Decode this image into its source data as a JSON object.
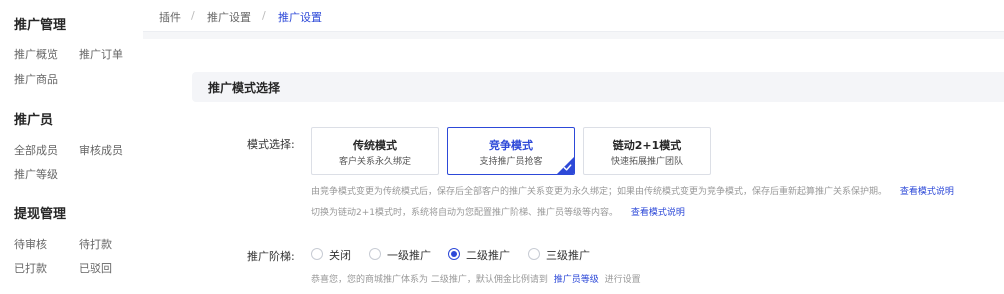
{
  "sidebar": {
    "sections": [
      {
        "title": "推广管理",
        "items": [
          "推广概览",
          "推广订单",
          "推广商品"
        ]
      },
      {
        "title": "推广员",
        "items": [
          "全部成员",
          "审核成员",
          "推广等级"
        ]
      },
      {
        "title": "提现管理",
        "items": [
          "待审核",
          "待打款",
          "已打款",
          "已驳回"
        ]
      }
    ]
  },
  "breadcrumb": [
    "插件",
    "推广设置",
    "推广设置"
  ],
  "breadcrumb_separator": "/",
  "section": {
    "title": "推广模式选择"
  },
  "mode": {
    "label": "模式选择:",
    "options": [
      {
        "title": "传统模式",
        "subtitle": "客户关系永久绑定"
      },
      {
        "title": "竞争模式",
        "subtitle": "支持推广员抢客"
      },
      {
        "title": "链动2+1模式",
        "subtitle": "快速拓展推广团队"
      }
    ],
    "selected": 1,
    "hint1": "由竞争模式变更为传统模式后，保存后全部客户的推广关系变更为永久绑定；如果由传统模式变更为竞争模式，保存后重新起算推广关系保护期。",
    "hint1_link": "查看模式说明",
    "hint2": "切换为链动2+1模式时，系统将自动为您配置推广阶梯、推广员等级等内容。",
    "hint2_link": "查看模式说明"
  },
  "ladder": {
    "label": "推广阶梯:",
    "options": [
      "关闭",
      "一级推广",
      "二级推广",
      "三级推广"
    ],
    "selected": 2,
    "hint_prefix": "恭喜您，您的商城推广体系为 二级推广，默认佣金比例请到",
    "hint_link": "推广员等级",
    "hint_suffix": "进行设置"
  },
  "colors": {
    "accent": "#2d49d8",
    "background": "#f5f6f8"
  }
}
